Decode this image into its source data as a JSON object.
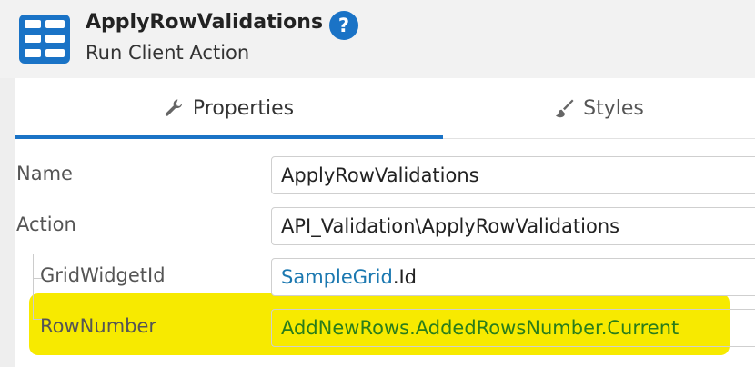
{
  "header": {
    "title": "ApplyRowValidations",
    "subtitle": "Run Client Action",
    "help_label": "?",
    "icon": "client-action-icon",
    "help_icon": "question-circle-icon",
    "accent_color": "#1a73c6"
  },
  "tabs": [
    {
      "label": "Properties",
      "icon": "wrench-icon",
      "active": true
    },
    {
      "label": "Styles",
      "icon": "brush-icon",
      "active": false
    }
  ],
  "properties": {
    "name": {
      "label": "Name",
      "value": "ApplyRowValidations"
    },
    "action": {
      "label": "Action",
      "value": "API_Validation\\ApplyRowValidations"
    },
    "grid_widget_id": {
      "label": "GridWidgetId",
      "value_object": "SampleGrid",
      "value_attr": ".Id"
    },
    "row_number": {
      "label": "RowNumber",
      "value": "AddNewRows.AddedRowsNumber.Current",
      "highlight_color": "#f7ea00"
    }
  }
}
